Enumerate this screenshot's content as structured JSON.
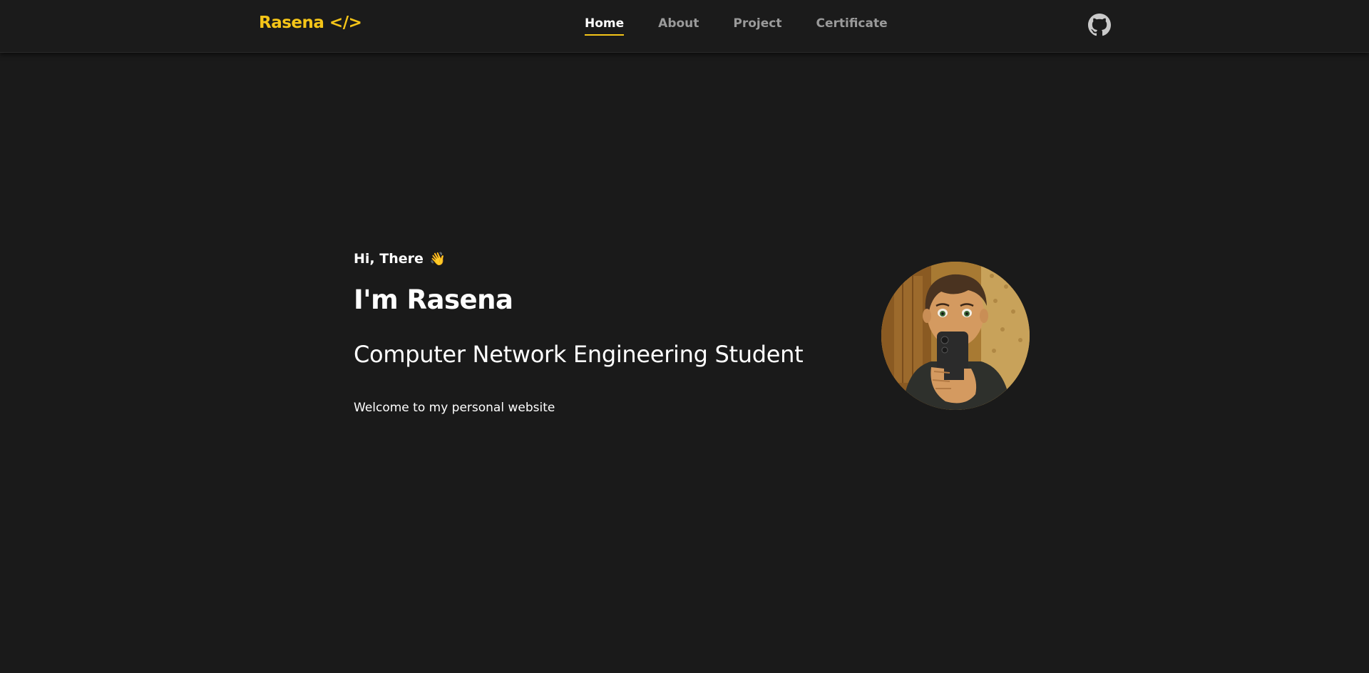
{
  "brand": {
    "name": "Rasena </>",
    "color": "#f5c518"
  },
  "nav": {
    "items": [
      {
        "label": "Home",
        "active": true
      },
      {
        "label": "About",
        "active": false
      },
      {
        "label": "Project",
        "active": false
      },
      {
        "label": "Certificate",
        "active": false
      }
    ]
  },
  "header": {
    "github_icon": "github-icon"
  },
  "hero": {
    "greeting": "Hi, There",
    "wave_emoji": "👋",
    "name": "I'm Rasena",
    "role": "Computer Network Engineering Student",
    "welcome": "Welcome to my personal website",
    "avatar": "avatar-illustration"
  },
  "colors": {
    "background": "#1a1a1a",
    "accent": "#f5c518",
    "nav_inactive": "#9a9a9a"
  }
}
